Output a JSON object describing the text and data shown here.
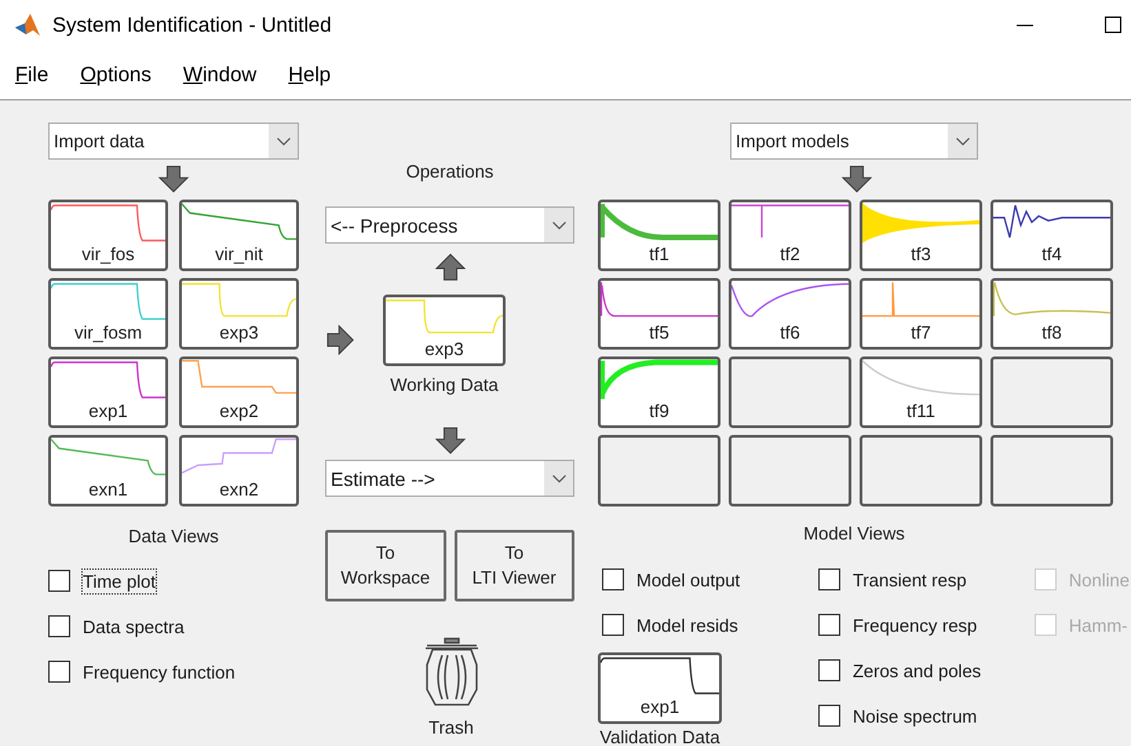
{
  "window": {
    "title": "System Identification - Untitled"
  },
  "menu": [
    {
      "label": "File"
    },
    {
      "label": "Options"
    },
    {
      "label": "Window"
    },
    {
      "label": "Help"
    }
  ],
  "data_panel": {
    "import_dropdown": {
      "value": "Import data"
    },
    "data_sets": [
      {
        "label": "vir_fos",
        "color": "#ff5a5a",
        "kind": "step-down"
      },
      {
        "label": "vir_nit",
        "color": "#33a533",
        "kind": "slope-step"
      },
      {
        "label": "vir_fosm",
        "color": "#40d0d0",
        "kind": "step-down"
      },
      {
        "label": "exp3",
        "color": "#f2e330",
        "kind": "step-recover"
      },
      {
        "label": "exp1",
        "color": "#cc33cc",
        "kind": "step-down"
      },
      {
        "label": "exp2",
        "color": "#ffa050",
        "kind": "stairs"
      },
      {
        "label": "exn1",
        "color": "#55bb55",
        "kind": "slope-step"
      },
      {
        "label": "exn2",
        "color": "#c8a0ff",
        "kind": "rise-steps"
      }
    ],
    "views_title": "Data Views",
    "views": [
      {
        "label": "Time plot",
        "checked": false,
        "focused": true
      },
      {
        "label": "Data spectra",
        "checked": false,
        "focused": false
      },
      {
        "label": "Frequency function",
        "checked": false,
        "focused": false
      }
    ]
  },
  "operations": {
    "title": "Operations",
    "preprocess": {
      "value": "<-- Preprocess"
    },
    "working_data": {
      "label": "exp3",
      "color": "#f2e330",
      "kind": "step-recover"
    },
    "working_caption": "Working Data",
    "estimate": {
      "value": "Estimate -->"
    },
    "buttons": [
      {
        "label": "To\nWorkspace"
      },
      {
        "label": "To\nLTI Viewer"
      }
    ],
    "trash": {
      "label": "Trash"
    }
  },
  "model_panel": {
    "import_dropdown": {
      "value": "Import models"
    },
    "models": [
      {
        "label": "tf1",
        "color": "#4cbb3c",
        "kind": "decay"
      },
      {
        "label": "tf2",
        "color": "#cc44cc",
        "kind": "spike-down"
      },
      {
        "label": "tf3",
        "color": "#ffe000",
        "kind": "ringing"
      },
      {
        "label": "tf4",
        "color": "#3a3ab0",
        "kind": "oscillate"
      },
      {
        "label": "tf5",
        "color": "#cc33cc",
        "kind": "fast-decay"
      },
      {
        "label": "tf6",
        "color": "#aa55ee",
        "kind": "undershoot"
      },
      {
        "label": "tf7",
        "color": "#ff9a40",
        "kind": "spike-up"
      },
      {
        "label": "tf8",
        "color": "#c8c050",
        "kind": "overshoot"
      },
      {
        "label": "tf9",
        "color": "#22ee22",
        "kind": "rise"
      },
      {
        "kind": "empty"
      },
      {
        "label": "tf11",
        "color": "#cccccc",
        "kind": "slow-decay"
      },
      {
        "kind": "empty"
      },
      {
        "kind": "empty"
      },
      {
        "kind": "empty"
      },
      {
        "kind": "empty"
      },
      {
        "kind": "empty"
      }
    ],
    "views_title": "Model Views",
    "view_columns": [
      [
        {
          "label": "Model output",
          "checked": false,
          "disabled": false
        },
        {
          "label": "Model resids",
          "checked": false,
          "disabled": false
        }
      ],
      [
        {
          "label": "Transient resp",
          "checked": false,
          "disabled": false
        },
        {
          "label": "Frequency resp",
          "checked": false,
          "disabled": false
        },
        {
          "label": "Zeros and poles",
          "checked": false,
          "disabled": false
        },
        {
          "label": "Noise spectrum",
          "checked": false,
          "disabled": false
        }
      ],
      [
        {
          "label": "Nonline",
          "checked": false,
          "disabled": true
        },
        {
          "label": "Hamm-",
          "checked": false,
          "disabled": true
        }
      ]
    ],
    "validation_data": {
      "label": "exp1",
      "color": "#303030",
      "kind": "step-down"
    },
    "validation_caption": "Validation Data"
  }
}
